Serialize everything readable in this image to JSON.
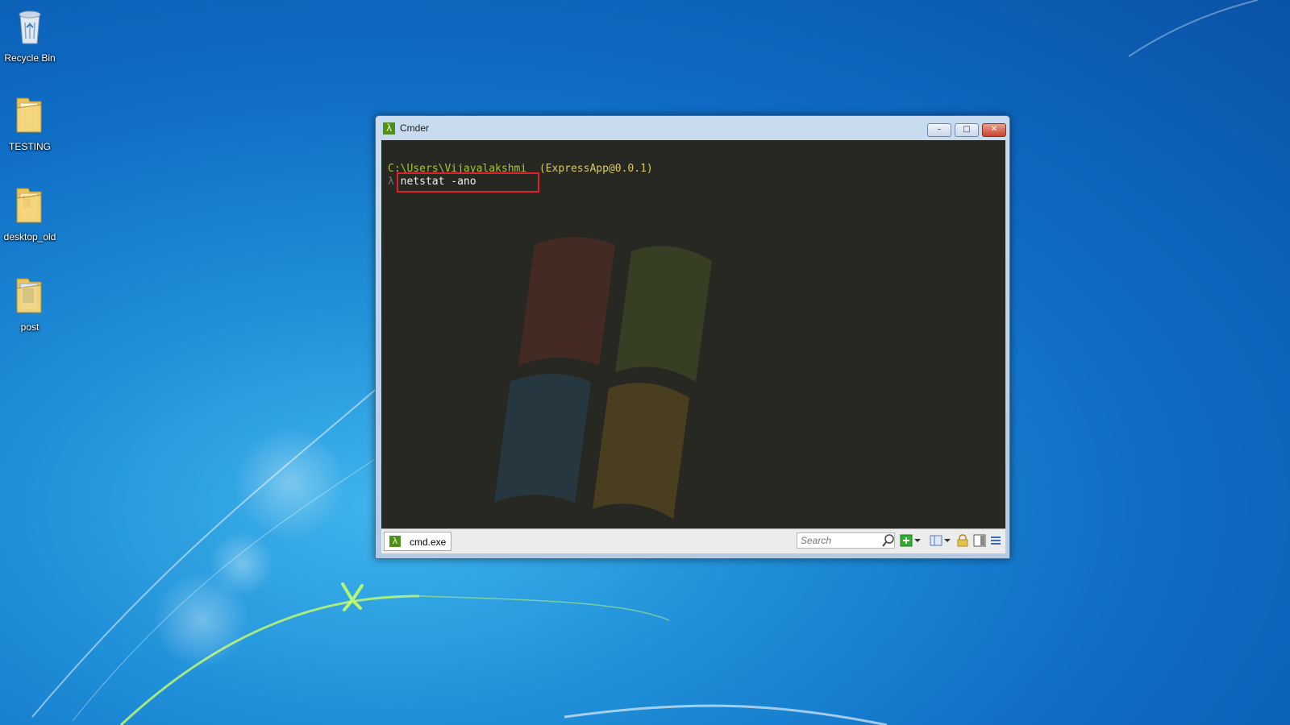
{
  "desktop": {
    "icons": [
      {
        "label": "Recycle Bin",
        "icon": "recycle-bin-icon"
      },
      {
        "label": "TESTING",
        "icon": "folder-icon"
      },
      {
        "label": "desktop_old",
        "icon": "folder-icon"
      },
      {
        "label": "post",
        "icon": "folder-icon"
      }
    ]
  },
  "window": {
    "title": "Cmder",
    "app_icon": "lambda",
    "controls": {
      "minimize": "–",
      "maximize": "□",
      "close": "✕"
    }
  },
  "console": {
    "path": "C:\\Users\\Vijayalakshmi",
    "branch": "(ExpressApp@0.0.1)",
    "prompt_symbol": "λ",
    "command": "netstat -ano"
  },
  "statusbar": {
    "tab_label": "cmd.exe",
    "search_placeholder": "Search"
  },
  "colors": {
    "console_bg": "#272822",
    "path_color": "#a6c236",
    "highlight_border": "#e0202a"
  }
}
